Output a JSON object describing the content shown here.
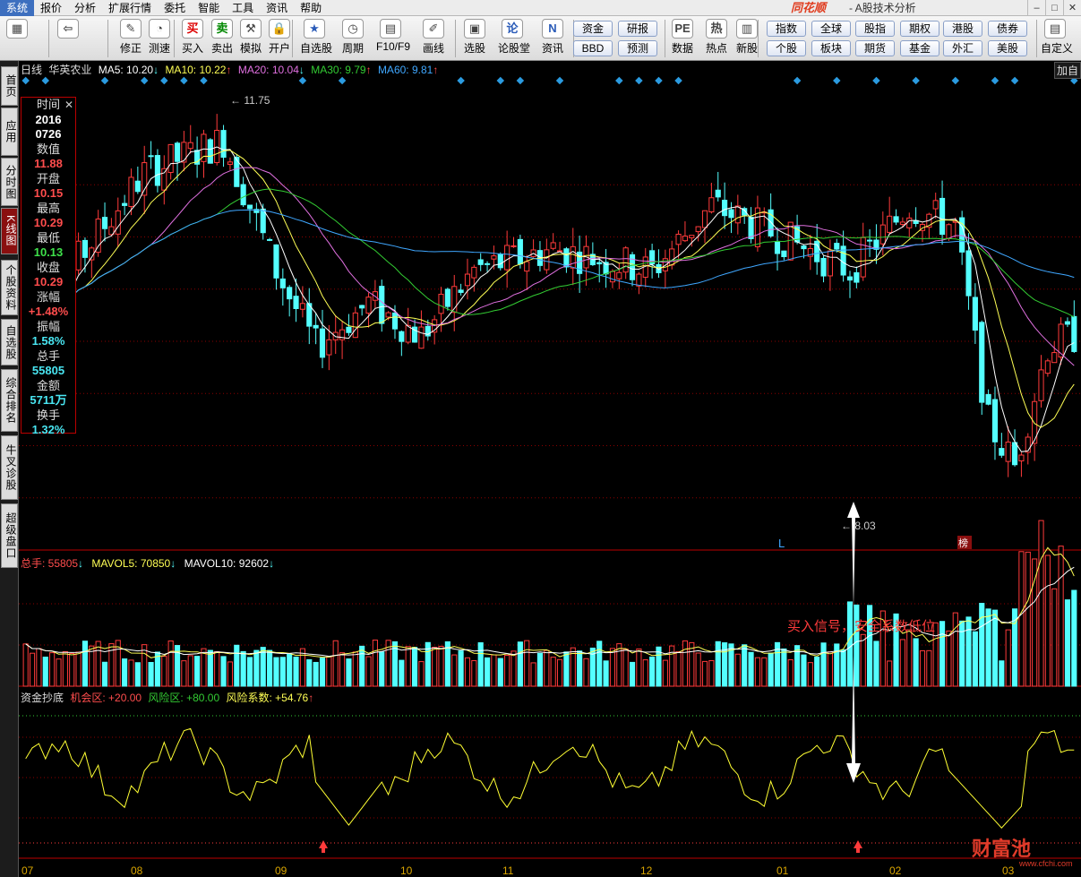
{
  "menubar": {
    "items": [
      "系统",
      "报价",
      "分析",
      "扩展行情",
      "委托",
      "智能",
      "工具",
      "资讯",
      "帮助"
    ],
    "brand": "同花顺",
    "brand_sub": "- A股技术分析"
  },
  "toolbar": {
    "main": [
      {
        "label": "",
        "icon": "grid-icon"
      },
      {
        "label": "",
        "icon": "back-arrow-icon"
      },
      {
        "label": "修正",
        "icon": "revise-icon"
      },
      {
        "label": "测速",
        "icon": "speed-icon"
      },
      {
        "label": "买入",
        "icon": "buy-icon"
      },
      {
        "label": "卖出",
        "icon": "sell-icon"
      },
      {
        "label": "模拟",
        "icon": "hammer-icon"
      },
      {
        "label": "开户",
        "icon": "lock-icon"
      },
      {
        "label": "自选股",
        "icon": "star-icon"
      },
      {
        "label": "周期",
        "icon": "clock-icon"
      },
      {
        "label": "F10/F9",
        "icon": "f10-icon"
      },
      {
        "label": "画线",
        "icon": "pen-icon"
      },
      {
        "label": "选股",
        "icon": "select-icon"
      },
      {
        "label": "论股堂",
        "icon": "lun-icon"
      },
      {
        "label": "资讯",
        "icon": "news-icon"
      },
      {
        "label": "数据",
        "icon": "pe-icon"
      },
      {
        "label": "热点",
        "icon": "hot-icon"
      },
      {
        "label": "新股",
        "icon": "ipo-icon"
      },
      {
        "label": "自定义",
        "icon": "custom-icon"
      }
    ],
    "quick": [
      "资金",
      "BBD",
      "研报",
      "预测",
      "指数",
      "个股",
      "全球",
      "板块",
      "股指",
      "期货",
      "期权",
      "基金",
      "港股",
      "外汇",
      "债券",
      "美股"
    ]
  },
  "left_tabs": [
    "首页",
    "应用",
    "分时图",
    "K线图",
    "个股资料",
    "自选股",
    "综合排名",
    "牛叉诊股",
    "超级盘口"
  ],
  "ma_row": {
    "period": "日线",
    "stock": "华英农业",
    "ma5": "MA5: 10.20",
    "ma10": "MA10: 10.22",
    "ma20": "MA20: 10.04",
    "ma30": "MA30: 9.79",
    "ma60": "MA60: 9.81",
    "add_label": "加自"
  },
  "info": {
    "time_label": "时间",
    "date1": "2016",
    "date2": "0726",
    "val_label": "数值",
    "val": "11.88",
    "open_label": "开盘",
    "open": "10.15",
    "high_label": "最高",
    "high": "10.29",
    "low_label": "最低",
    "low": "10.13",
    "close_label": "收盘",
    "close": "10.29",
    "chg_label": "涨幅",
    "chg": "+1.48%",
    "amp_label": "振幅",
    "amp": "1.58%",
    "vol_label": "总手",
    "vol": "55805",
    "amt_label": "金额",
    "amt": "5711万",
    "turn_label": "换手",
    "turn": "1.32%"
  },
  "vol_row": {
    "total": "总手: 55805",
    "mavol5": "MAVOL5: 70850",
    "mavol10": "MAVOL10: 92602"
  },
  "ind_row": {
    "name": "资金抄底",
    "chance": "机会区: +20.00",
    "risk": "风险区: +80.00",
    "coef": "风险系数: +54.76"
  },
  "annotations": {
    "high": "11.75",
    "low": "8.03",
    "signal": "买入信号，安全系数低位",
    "l_mark": "L",
    "bang": "榜"
  },
  "xaxis": [
    "07",
    "08",
    "09",
    "10",
    "11",
    "12",
    "01",
    "02",
    "03"
  ],
  "watermark": {
    "text": "财富池",
    "url": "www.cfchi.com"
  },
  "colors": {
    "up": "#ff3b3b",
    "down": "#54ffff",
    "ma5": "#ffffff",
    "ma10": "#ffff55",
    "ma20": "#e070e0",
    "ma30": "#33cc33",
    "ma60": "#3fa7ff",
    "grid": "#8b0000"
  },
  "chart_data": {
    "type": "candlestick",
    "ylim": [
      8.03,
      11.75
    ],
    "n_candles": 160
  }
}
